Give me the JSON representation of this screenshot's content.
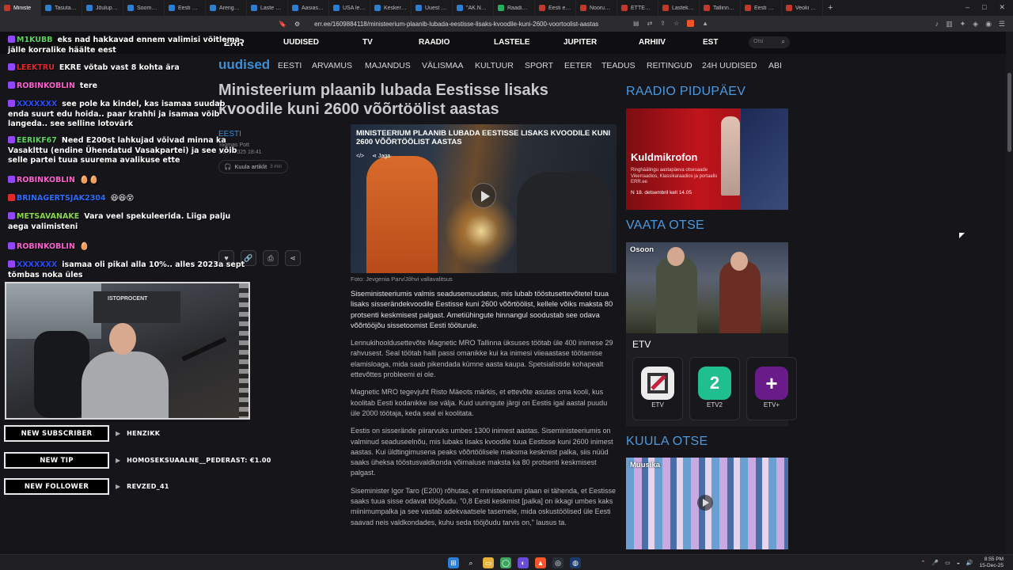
{
  "browser": {
    "tabs": [
      {
        "label": "Ministe",
        "color": "#c0392b",
        "active": true
      },
      {
        "label": "Tasuta laste",
        "color": "#2d7dd2"
      },
      {
        "label": "Jõuluperioo",
        "color": "#2d7dd2"
      },
      {
        "label": "Soomes ela",
        "color": "#2d7dd2"
      },
      {
        "label": "Eesti MEP-i",
        "color": "#2d7dd2"
      },
      {
        "label": "Arenguseire",
        "color": "#2d7dd2"
      },
      {
        "label": "Laste mängu",
        "color": "#2d7dd2"
      },
      {
        "label": "Aasiast tellit",
        "color": "#2d7dd2"
      },
      {
        "label": "USA leevend",
        "color": "#2d7dd2"
      },
      {
        "label": "Keskerakon",
        "color": "#2d7dd2"
      },
      {
        "label": "Uuest aasta",
        "color": "#2d7dd2"
      },
      {
        "label": "\"AK.Nädal\"",
        "color": "#2d7dd2"
      },
      {
        "label": "Raadio 2 aas",
        "color": "#27ae60"
      },
      {
        "label": "Eesti ettevõ",
        "color": "#c0392b"
      },
      {
        "label": "Noorus tahe",
        "color": "#c0392b"
      },
      {
        "label": "ETTEVAATUS",
        "color": "#c0392b"
      },
      {
        "label": "Lastekodula",
        "color": "#c0392b"
      },
      {
        "label": "Tallinnas pe",
        "color": "#c0392b"
      },
      {
        "label": "Eesti Kesker",
        "color": "#c0392b"
      },
      {
        "label": "Veoki sõidu",
        "color": "#c0392b"
      }
    ],
    "new_tab": "+",
    "window_controls": [
      "–",
      "□",
      "✕"
    ],
    "url": "err.ee/1609884118/ministeerium-plaanib-lubada-eestisse-lisaks-kvoodile-kuni-2600-voortoolist-aastas"
  },
  "chat": {
    "messages": [
      {
        "user": "M1KUBB",
        "user_color": "#5bd25b",
        "badge": "#9146ff",
        "text": "eks nad hakkavad ennem valimisi võitlema jälle korralike häälte eest"
      },
      {
        "user": "LEEKTRU",
        "user_color": "#e02a2a",
        "badge": "#9146ff",
        "text": "EKRE võtab vast 8 kohta ära"
      },
      {
        "user": "ROBINKOBLIN",
        "user_color": "#ff5fd2",
        "badge": "#9146ff",
        "text": "tere"
      },
      {
        "user": "XXXXXXX",
        "user_color": "#2a4bff",
        "badge": "#9146ff",
        "text": "see pole ka kindel, kas isamaa suudab enda suurt edu hoida.. paar krahhi ja isamaa võib langeda.. see selline lotovärk"
      },
      {
        "user": "EERIKF67",
        "user_color": "#5bd25b",
        "badge": "#9146ff",
        "text": "Need E200st lahkujad võivad minna ka Vasaklttu (endine Ühendatud Vasakpartei) ja see võib selle partei tuua suurema avalikuse ette"
      },
      {
        "user": "ROBINKOBLIN",
        "user_color": "#ff5fd2",
        "badge": "#9146ff",
        "text": "🥚🥚"
      },
      {
        "user": "BRINAGERTSJAK2304",
        "user_color": "#2a6dff",
        "badge": "#e02a2a",
        "text": "😆😆😵"
      },
      {
        "user": "METSAVANAKE",
        "user_color": "#8ad84a",
        "badge": "#9146ff",
        "text": "Vara veel spekuleerida. Liiga palju aega valimisteni"
      },
      {
        "user": "ROBINKOBLIN",
        "user_color": "#ff5fd2",
        "badge": "#9146ff",
        "text": "🥚"
      },
      {
        "user": "XXXXXXX",
        "user_color": "#2a4bff",
        "badge": "#9146ff",
        "text": "isamaa oli pikal alla 10%.. alles 2023a sept tõmbas noka üles"
      }
    ]
  },
  "cam": {
    "shelf_label": "ISTOPROCENT"
  },
  "alerts": [
    {
      "label": "NEW SUBSCRIBER",
      "value": "HENZIKK"
    },
    {
      "label": "NEW TIP",
      "value": "HOMOSEKSUAALNE__PEDERAST: €1.00"
    },
    {
      "label": "NEW FOLLOWER",
      "value": "REVZED_41"
    }
  ],
  "site": {
    "logo": "ERR",
    "topnav": [
      "UUDISED",
      "TV",
      "RAADIO",
      "LASTELE",
      "JUPITER",
      "ARHIIV",
      "EST"
    ],
    "search_placeholder": "Otsi",
    "brand": "uudised",
    "subnav": [
      "EESTI",
      "ARVAMUS",
      "MAJANDUS",
      "VÄLISMAA",
      "KULTUUR",
      "SPORT",
      "EETER",
      "TEADUS",
      "REITINGUD",
      "24H UUDISED",
      "ABI"
    ],
    "article": {
      "headline": "Ministeerium plaanib lubada Eestisse lisaks kvoodile kuni 2600 võõrtöölist aastas",
      "category": "EESTI",
      "author": "Toomas Pott",
      "date": "15.12.2025 18:41",
      "listen_label": "Kuula artiklit",
      "listen_duration": "3 min",
      "video_title": "Ministeerium plaanib lubada Eestisse lisaks kvoodile kuni 2600 võõrtöölist aastas",
      "share_label": "Jaga",
      "photo_credit": "Foto: Jevgenia Parv/Jõhvi vallavalitsus",
      "paragraphs": [
        "Siseministeeriumis valmis seadusemuudatus, mis lubab tööstusettevõtetel tuua lisaks sisserändekvoodile Eestisse kuni 2600 võõrtöölist, kellele võiks maksta 80 protsenti keskmisest palgast. Ametiühingute hinnangul soodustab see odava võõrtööjõu sissetoomist Eesti tööturule.",
        "Lennukihooldusettevõte Magnetic MRO Tallinna üksuses töötab üle 400 inimese 29 rahvusest. Seal töötab halli passi omanikke kui ka inimesi viieaastase töötamise elamisloaga, mida saab pikendada kümne aasta kaupa. Spetsialistide kohapealt ettevõttes probleemi ei ole.",
        "Magnetic MRO tegevjuht Risto Mäeots märkis, et ettevõte asutas oma kooli, kus koolitab Eesti kodanikke ise välja. Kuid uuringute järgi on Eestis igal aastal puudu üle 2000 töötaja, keda seal ei koolitata.",
        "Eestis on sisserände piirarvuks umbes 1300 inimest aastas. Siseministeeriumis on valminud seaduseelnõu, mis lubaks lisaks kvoodile tuua Eestisse kuni 2600 inimest aastas. Kui üldtingimusena peaks võõrtöölisele maksma keskmist palka, siis nüüd saaks üheksa tööstusvaldkonda võimaluse maksta ka 80 protsenti keskmisest palgast.",
        "Siseminister Igor Taro (E200) rõhutas, et ministeeriumi plaan ei tähenda, et Eestisse saaks tuua sisse odavat tööjõudu. \"0,8 Eesti keskmist [palka] on ikkagi umbes kaks miinimumpalka ja see vastab adekvaatsele tasemele, mida oskustöölised üle Eesti saavad neis valdkondades, kuhu seda tööjõudu tarvis on,\" lausus ta."
      ]
    },
    "sidebar": {
      "radio_day_heading": "RAADIO PIDUPÄEV",
      "promo_title": "Kuldmikrofon",
      "promo_text": "Ringhäälingu aastapäeva otsesaade Vikerraadios, Klassikaraadios ja portaalis ERR.ee",
      "promo_date": "N 18. detsembril kell 14.05",
      "watch_live_heading": "VAATA OTSE",
      "live_show": "Osoon",
      "tv_section": "ETV",
      "channels": [
        {
          "name": "ETV",
          "logo": "etv-logo-icon"
        },
        {
          "name": "ETV2",
          "logo": "etv2-logo-icon"
        },
        {
          "name": "ETV+",
          "logo": "etvplus-logo-icon"
        }
      ],
      "listen_live_heading": "KUULA OTSE",
      "radio_show": "Muusika"
    }
  },
  "taskbar": {
    "time": "8:55 PM",
    "date": "15-Dec-25"
  }
}
